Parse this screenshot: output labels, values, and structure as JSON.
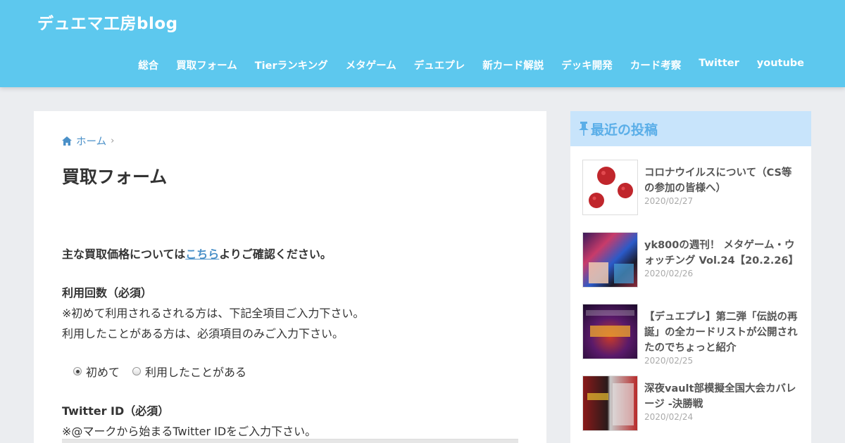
{
  "header": {
    "site_title": "デュエマ工房blog",
    "nav": [
      "総合",
      "買取フォーム",
      "Tierランキング",
      "メタゲーム",
      "デュエプレ",
      "新カード解説",
      "デッキ開発",
      "カード考察",
      "Twitter",
      "youtube"
    ]
  },
  "breadcrumb": {
    "home": "ホーム"
  },
  "page": {
    "title": "買取フォーム",
    "lead_before": "主な買取価格については",
    "lead_link": "こちら",
    "lead_after": "よりご確認ください。",
    "usage_head": "利用回数（必須）",
    "usage_note1": "※初めて利用されるされる方は、下記全項目ご入力下さい。",
    "usage_note2": "利用したことがある方は、必須項目のみご入力下さい。",
    "radio_first": "初めて",
    "radio_used": "利用したことがある",
    "twitter_head": "Twitter ID（必須）",
    "twitter_note": "※@マークから始まるTwitter IDをご入力下さい。"
  },
  "sidebar": {
    "heading": "最近の投稿",
    "posts": [
      {
        "title": "コロナウイルスについて（CS等の参加の皆様へ）",
        "date": "2020/02/27"
      },
      {
        "title": "yk800の週刊！ メタゲーム・ウォッチング Vol.24【20.2.26】",
        "date": "2020/02/26"
      },
      {
        "title": "【デュエプレ】第二弾「伝説の再誕」の全カードリストが公開されたのでちょっと紹介",
        "date": "2020/02/25"
      },
      {
        "title": "深夜vault部模擬全国大会カバレージ -決勝戦",
        "date": "2020/02/24"
      }
    ]
  },
  "colors": {
    "header_bg": "#5dc8ee",
    "link": "#4a90c8",
    "sidebar_head_bg": "#c8e4fb"
  }
}
